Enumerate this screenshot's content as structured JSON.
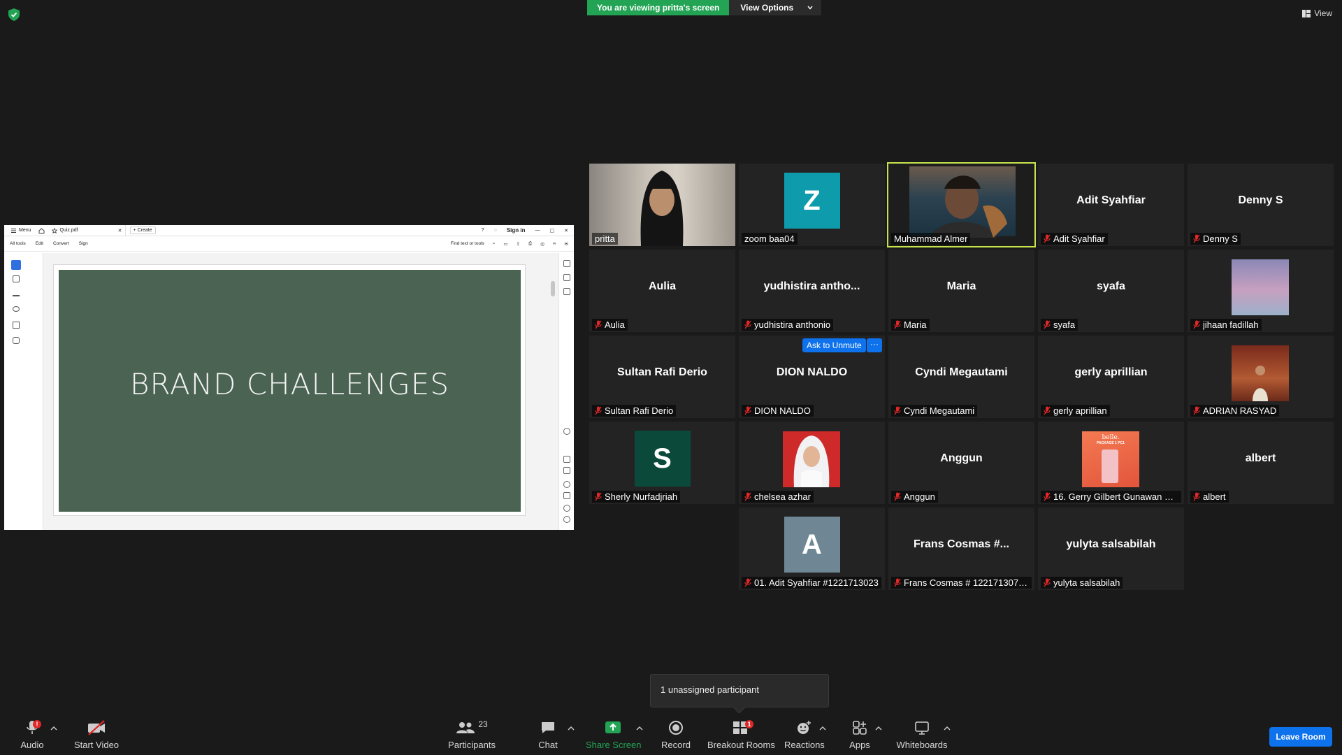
{
  "top": {
    "viewing_banner": "You are viewing pritta's screen",
    "view_options": "View Options",
    "view_label": "View"
  },
  "shared": {
    "tab_menu": "Menu",
    "tab_file": "Quiz.pdf",
    "tab_create": "Create",
    "sign_in": "Sign in",
    "menu_items": [
      "All tools",
      "Edit",
      "Convert",
      "Sign"
    ],
    "find": "Find text or tools",
    "slide_title": "BRAND CHALLENGES"
  },
  "participants": [
    {
      "name": "pritta",
      "label": "pritta",
      "type": "video-woman",
      "muted": false
    },
    {
      "name": "zoom baa04",
      "label": "zoom baa04",
      "type": "avatar",
      "letter": "Z",
      "color": "#0e9bab",
      "muted": false
    },
    {
      "name": "Muhammad Almer",
      "label": "Muhammad Almer",
      "type": "video-man",
      "muted": false,
      "active": true
    },
    {
      "name": "Adit Syahfiar",
      "label": "Adit Syahfiar",
      "type": "name",
      "muted": true
    },
    {
      "name": "Denny S",
      "label": "Denny S",
      "type": "name",
      "muted": true
    },
    {
      "name": "Aulia",
      "label": "Aulia",
      "type": "name",
      "muted": true
    },
    {
      "name": "yudhistira  antho...",
      "label": "yudhistira anthonio",
      "type": "name",
      "muted": true
    },
    {
      "name": "Maria",
      "label": "Maria",
      "type": "name",
      "muted": true
    },
    {
      "name": "syafa",
      "label": "syafa",
      "type": "name",
      "muted": true
    },
    {
      "name": "jihaan fadillah",
      "label": "jihaan fadillah",
      "type": "photo-sky",
      "muted": true
    },
    {
      "name": "Sultan Rafi Derio",
      "label": "Sultan Rafi Derio",
      "type": "name",
      "muted": true
    },
    {
      "name": "DION NALDO",
      "label": "DION NALDO",
      "type": "name",
      "muted": true
    },
    {
      "name": "Cyndi Megautami",
      "label": "Cyndi Megautami",
      "type": "name",
      "muted": true
    },
    {
      "name": "gerly aprillian",
      "label": "gerly aprillian",
      "type": "name",
      "muted": true
    },
    {
      "name": "ADRIAN RASYAD",
      "label": "ADRIAN RASYAD",
      "type": "photo-man",
      "muted": true
    },
    {
      "name": "Sherly Nurfadjriah",
      "label": "Sherly Nurfadjriah",
      "type": "avatar",
      "letter": "S",
      "color": "#0b4a3a",
      "muted": true
    },
    {
      "name": "chelsea azhar",
      "label": "chelsea azhar",
      "type": "photo-hijab",
      "muted": true
    },
    {
      "name": "Anggun",
      "label": "Anggun",
      "type": "name",
      "muted": true
    },
    {
      "name": "16. Gerry Gilbert Gunawan #1...",
      "label": "16. Gerry Gilbert Gunawan #1...",
      "type": "photo-belle",
      "muted": true
    },
    {
      "name": "albert",
      "label": "albert",
      "type": "name",
      "muted": true
    },
    {
      "name": "01. Adit Syahfiar #1221713023",
      "label": "01. Adit Syahfiar #1221713023",
      "type": "avatar",
      "letter": "A",
      "color": "#6f8794",
      "muted": true
    },
    {
      "name": "Frans Cosmas #...",
      "label": "Frans Cosmas # 1221713074 ...",
      "type": "name",
      "muted": true
    },
    {
      "name": "yulyta salsabilah",
      "label": "yulyta salsabilah",
      "type": "name",
      "muted": true
    }
  ],
  "belle_text": "belle.",
  "belle_sub": "PACKAGE 1 PC1",
  "ask_to_unmute": "Ask to Unmute",
  "ask_more": "···",
  "tooltip": "1 unassigned participant",
  "toolbar": {
    "audio": "Audio",
    "start_video": "Start Video",
    "participants": "Participants",
    "participants_count": "23",
    "chat": "Chat",
    "share_screen": "Share Screen",
    "record": "Record",
    "breakout_rooms": "Breakout Rooms",
    "breakout_badge": "1",
    "audio_badge": "!",
    "reactions": "Reactions",
    "apps": "Apps",
    "whiteboards": "Whiteboards",
    "leave": "Leave Room"
  },
  "colors": {
    "green": "#23a455",
    "blue": "#0e72ed",
    "active_border": "#c7e34b",
    "slide": "#4a6352"
  }
}
